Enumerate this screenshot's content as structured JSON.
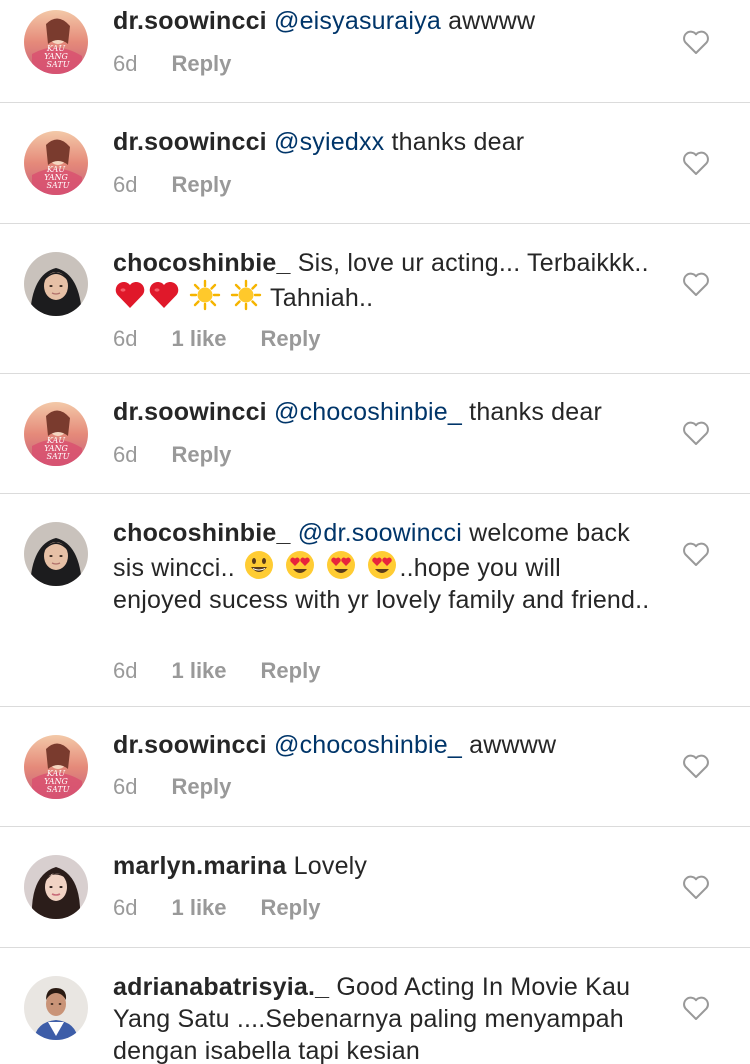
{
  "comments": [
    {
      "username": "dr.soowincci",
      "mention": "@eisyasuraiya",
      "text": " awwww",
      "time": "6d",
      "likes": "",
      "reply": "Reply",
      "avatar": "poster-avatar"
    },
    {
      "username": "dr.soowincci",
      "mention": "@syiedxx",
      "text": " thanks dear",
      "time": "6d",
      "likes": "",
      "reply": "Reply",
      "avatar": "poster-avatar"
    },
    {
      "username": "chocoshinbie_",
      "mention": "",
      "text_a": "Sis, love ur acting... Terbaikkk..",
      "text_b": "Tahniah..",
      "emojis": [
        "red-heart",
        "red-heart",
        "sun",
        "sun"
      ],
      "time": "6d",
      "likes": "1 like",
      "reply": "Reply",
      "avatar": "woman-hijab-avatar"
    },
    {
      "username": "dr.soowincci",
      "mention": "@chocoshinbie_",
      "text": " thanks dear",
      "time": "6d",
      "likes": "",
      "reply": "Reply",
      "avatar": "poster-avatar"
    },
    {
      "username": "chocoshinbie_",
      "mention": "@dr.soowincci",
      "text_a": " welcome back sis wincci..",
      "text_b": "..hope you will enjoyed sucess with yr lovely family and friend..",
      "emojis": [
        "smiley",
        "heart-eyes",
        "heart-eyes",
        "heart-eyes"
      ],
      "time": "6d",
      "likes": "1 like",
      "reply": "Reply",
      "avatar": "woman-hijab-avatar"
    },
    {
      "username": "dr.soowincci",
      "mention": "@chocoshinbie_",
      "text": " awwww",
      "time": "6d",
      "likes": "",
      "reply": "Reply",
      "avatar": "poster-avatar"
    },
    {
      "username": "marlyn.marina",
      "mention": "",
      "text": "Lovely",
      "time": "6d",
      "likes": "1 like",
      "reply": "Reply",
      "avatar": "woman-selfie-avatar"
    },
    {
      "username": "adrianabatrisyia._",
      "mention": "",
      "text": "Good Acting In Movie Kau Yang Satu ....Sebenarnya paling menyampah dengan isabella tapi kesian",
      "time": "",
      "likes": "",
      "reply": "",
      "avatar": "man-avatar"
    }
  ],
  "poster_avatar_text": [
    "KAU",
    "YANG",
    "SATU"
  ],
  "colors": {
    "username": "#262626",
    "mention": "#003569",
    "meta": "#999999",
    "divider": "#dbdbdb",
    "heart_outline": "#999999"
  },
  "icons": {
    "like": "heart-outline-icon"
  }
}
